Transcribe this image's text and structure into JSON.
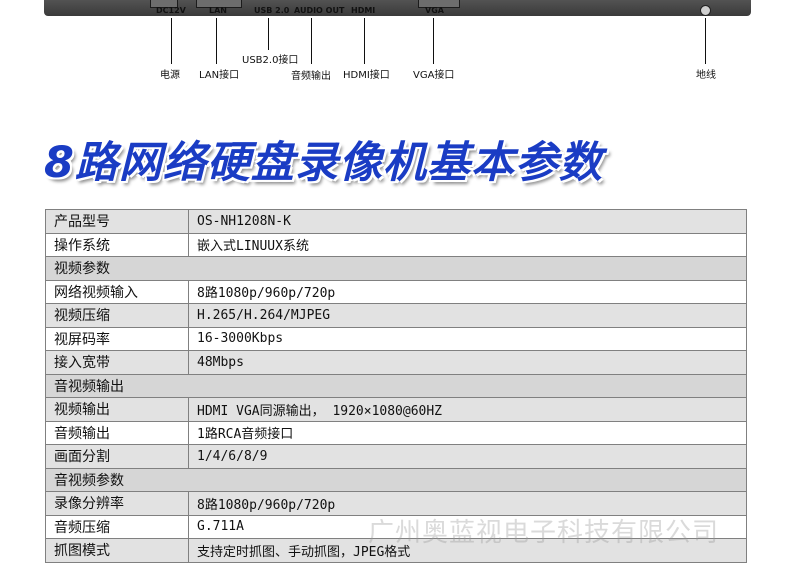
{
  "device": {
    "port_labels": [
      "DC12V",
      "LAN",
      "USB 2.0",
      "AUDIO OUT",
      "HDMI",
      "VGA"
    ],
    "callouts": [
      "电源",
      "LAN接口",
      "USB2.0接口",
      "音频输出",
      "HDMI接口",
      "VGA接口",
      "地线"
    ]
  },
  "heading": "8路网络硬盘录像机基本参数",
  "spec_table": {
    "rows": [
      {
        "type": "row",
        "key": "产品型号",
        "value": "OS-NH1208N-K"
      },
      {
        "type": "row",
        "key": "操作系统",
        "value": "嵌入式LINUUX系统"
      },
      {
        "type": "section",
        "key": "视频参数"
      },
      {
        "type": "row",
        "key": "网络视频输入",
        "value": "8路1080p/960p/720p"
      },
      {
        "type": "row",
        "key": "视频压缩",
        "value": "H.265/H.264/MJPEG"
      },
      {
        "type": "row",
        "key": "视屏码率",
        "value": "16-3000Kbps"
      },
      {
        "type": "row",
        "key": "接入宽带",
        "value": "48Mbps"
      },
      {
        "type": "section",
        "key": "音视频输出"
      },
      {
        "type": "row",
        "key": "视频输出",
        "value": "HDMI VGA同源输出， 1920×1080@60HZ"
      },
      {
        "type": "row",
        "key": "音频输出",
        "value": "1路RCA音频接口"
      },
      {
        "type": "row",
        "key": "画面分割",
        "value": "1/4/6/8/9"
      },
      {
        "type": "section",
        "key": "音视频参数"
      },
      {
        "type": "row",
        "key": "录像分辨率",
        "value": "8路1080p/960p/720p"
      },
      {
        "type": "row",
        "key": "音频压缩",
        "value": "G.711A"
      },
      {
        "type": "row",
        "key": "抓图模式",
        "value": "支持定时抓图、手动抓图，JPEG格式"
      }
    ]
  },
  "watermark": "广州奥蓝视电子科技有限公司"
}
